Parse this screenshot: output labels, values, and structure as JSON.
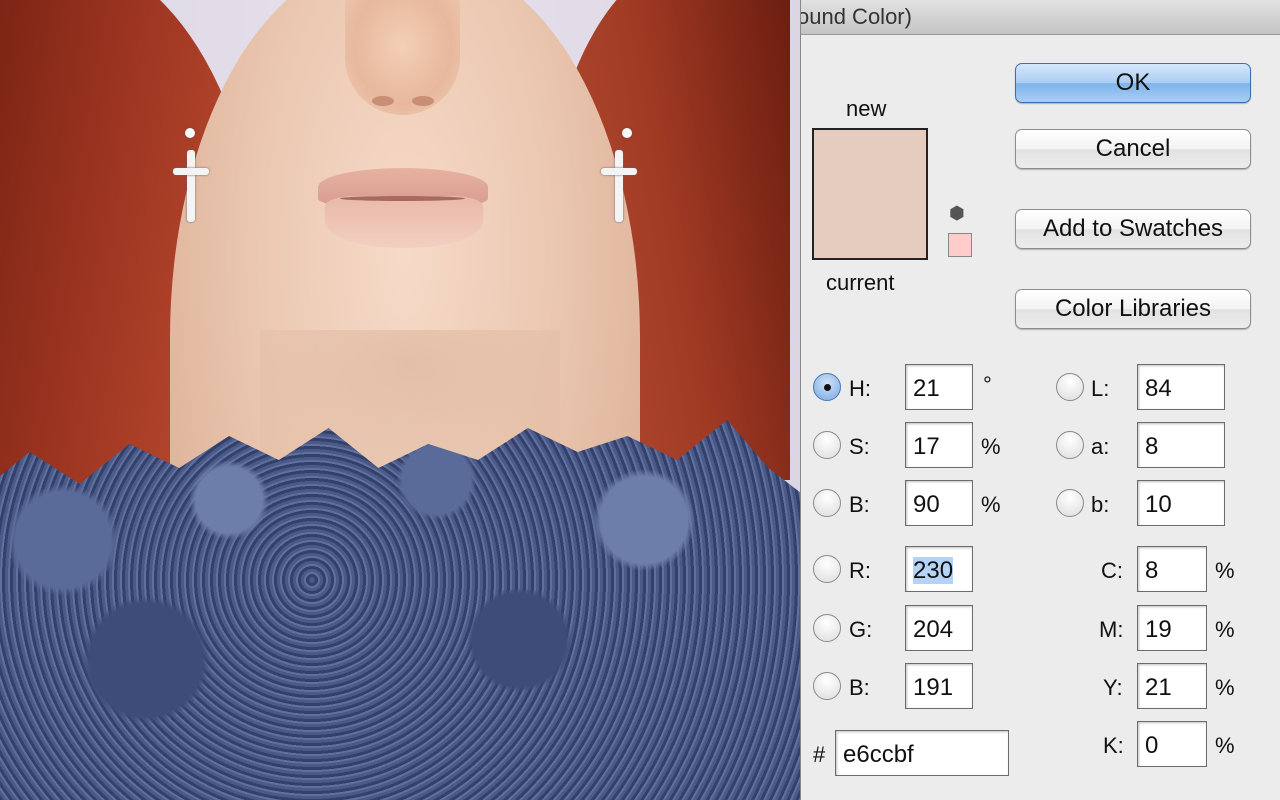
{
  "dialog": {
    "title": "ound Color)",
    "new_label": "new",
    "current_label": "current",
    "new_color": "#e6ccbf",
    "current_color": "#e6ccbf",
    "websafe_color": "#ffcccc",
    "buttons": {
      "ok": "OK",
      "cancel": "Cancel",
      "add_to_swatches": "Add to Swatches",
      "color_libraries": "Color Libraries"
    },
    "hsb": {
      "h": {
        "label": "H:",
        "value": "21",
        "unit": "°",
        "selected": true
      },
      "s": {
        "label": "S:",
        "value": "17",
        "unit": "%"
      },
      "b": {
        "label": "B:",
        "value": "90",
        "unit": "%"
      }
    },
    "rgb": {
      "r": {
        "label": "R:",
        "value": "230"
      },
      "g": {
        "label": "G:",
        "value": "204"
      },
      "b": {
        "label": "B:",
        "value": "191"
      }
    },
    "lab": {
      "l": {
        "label": "L:",
        "value": "84"
      },
      "a": {
        "label": "a:",
        "value": "8"
      },
      "b": {
        "label": "b:",
        "value": "10"
      }
    },
    "cmyk": {
      "c": {
        "label": "C:",
        "value": "8",
        "unit": "%"
      },
      "m": {
        "label": "M:",
        "value": "19",
        "unit": "%"
      },
      "y": {
        "label": "Y:",
        "value": "21",
        "unit": "%"
      },
      "k": {
        "label": "K:",
        "value": "0",
        "unit": "%"
      }
    },
    "hex": {
      "label": "#",
      "value": "e6ccbf"
    }
  }
}
